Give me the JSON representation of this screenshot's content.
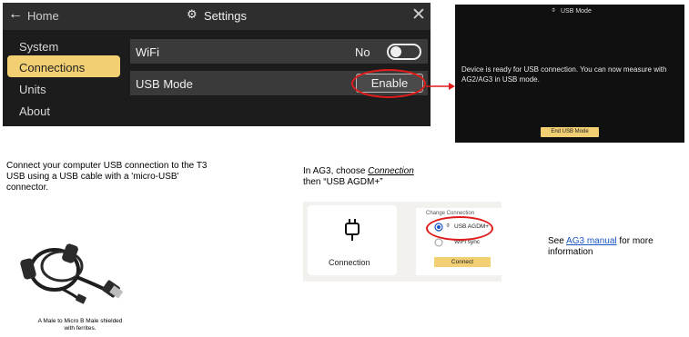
{
  "settings_panel": {
    "back_label": "Home",
    "title": "Settings",
    "sidebar": [
      "System",
      "Connections",
      "Units",
      "About"
    ],
    "selected_sidebar": "Connections",
    "wifi_label": "WiFi",
    "wifi_value": "No",
    "usb_label": "USB Mode",
    "usb_button": "Enable",
    "colors": {
      "accent": "#f2cf73",
      "highlight": "#e01b1b"
    }
  },
  "usb_panel": {
    "title": "USB Mode",
    "message": "Device is ready for USB connection. You can now measure with AG2/AG3 in USB mode.",
    "button": "End USB Mode"
  },
  "left_instructions": {
    "text": "Connect your computer USB connection to the T3 USB using a USB cable with a 'micro-USB' connector.",
    "caption": "A Male to Micro B Male shielded with ferrites."
  },
  "ag3_instructions": {
    "prefix": "In AG3, choose ",
    "emphasis": "Connection",
    "suffix": "then “USB AGDM+”",
    "card_label": "Connection",
    "popup_title": "Change Connection",
    "option_usb": "USB AGDM+",
    "option_wifi": "WiFi sync",
    "connect_button": "Connect"
  },
  "see_more": {
    "prefix": "See ",
    "link": "AG3 manual",
    "suffix": " for more information"
  }
}
